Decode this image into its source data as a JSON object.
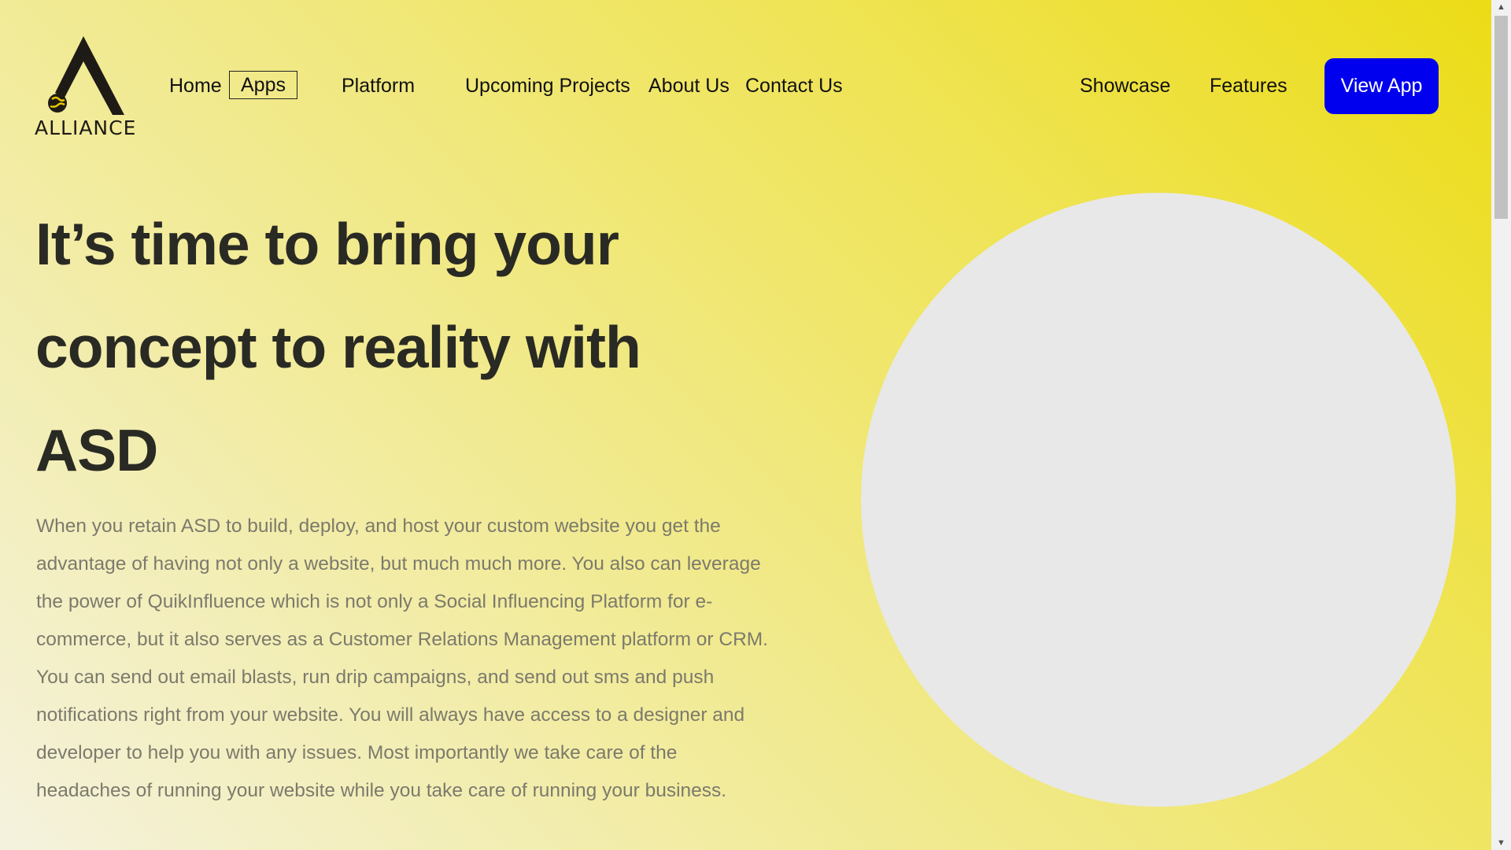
{
  "header": {
    "logo_text": "ALLIANCE",
    "nav": {
      "home": "Home",
      "apps": "Apps",
      "platform": "Platform",
      "upcoming": "Upcoming Projects",
      "about": "About Us",
      "contact": "Contact Us",
      "showcase": "Showcase",
      "features": "Features"
    },
    "cta_label": "View App"
  },
  "hero": {
    "headline_line1": "It’s time to bring your",
    "headline_line2": "concept to reality with",
    "headline_line3": "ASD",
    "body": "When you retain ASD to build, deploy, and host your custom website you get the advantage of having not only a website, but much much more. You also can leverage the power of QuikInfluence which is not only a Social Influencing Platform for e-commerce, but it also serves as a Customer Relations Management platform or CRM. You can send out email blasts, run drip campaigns, and send out sms and push notifications right from your website. You will always have access to a designer and developer to help you with any issues. Most importantly we take care of the headaches of running your website while you take care of running your business."
  },
  "colors": {
    "accent": "#0000ee",
    "background_start": "#ecdc16",
    "background_end": "#f4f2de",
    "circle": "#e8e8e8"
  },
  "icons": {
    "logo": "alliance-logo-icon",
    "scroll_up": "scroll-up-arrow-icon",
    "scroll_down": "scroll-down-arrow-icon"
  }
}
